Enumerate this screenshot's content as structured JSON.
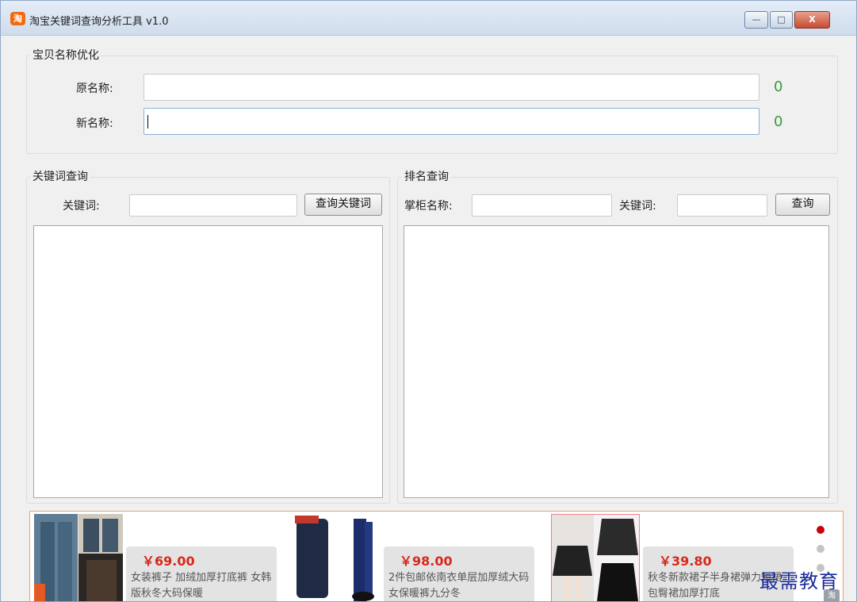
{
  "window": {
    "title": "淘宝关键词查询分析工具 v1.0",
    "app_icon_glyph": "淘",
    "controls": {
      "minimize": "—",
      "maximize": "□",
      "close": "X"
    }
  },
  "name_optimize": {
    "legend": "宝贝名称优化",
    "original_label": "原名称:",
    "original_value": "",
    "original_count": "0",
    "new_label": "新名称:",
    "new_value": "",
    "new_count": "0"
  },
  "keyword_query": {
    "legend": "关键词查询",
    "keyword_label": "关键词:",
    "keyword_value": "",
    "button_label": "查询关键词"
  },
  "rank_query": {
    "legend": "排名查询",
    "shop_label": "掌柜名称:",
    "shop_value": "",
    "keyword_label": "关键词:",
    "keyword_value": "",
    "button_label": "查询"
  },
  "ads": [
    {
      "price": "￥69.00",
      "description": "女装裤子 加绒加厚打底裤 女韩版秋冬大码保暖"
    },
    {
      "price": "￥98.00",
      "description": "2件包邮依南衣单层加厚绒大码女保暖裤九分冬"
    },
    {
      "price": "￥39.80",
      "description": "秋冬新款裙子半身裙弹力短裙包臀裙加厚打底"
    }
  ],
  "carousel": {
    "active_index": 0,
    "count": 3
  },
  "watermark": {
    "text": "最需教育",
    "icon_glyph": "淘"
  },
  "colors": {
    "count_green": "#3a9a3a",
    "price_red": "#d8281b",
    "ad_border": "#f0a070",
    "active_dot": "#c9000a"
  }
}
